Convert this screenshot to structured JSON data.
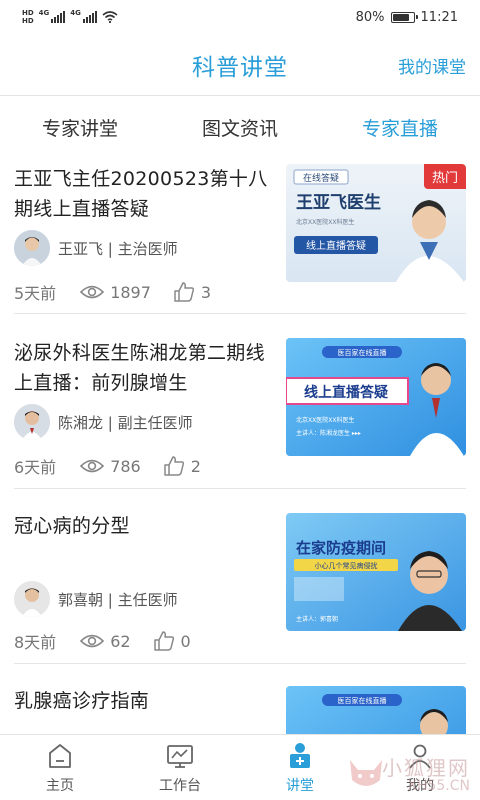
{
  "status_bar": {
    "hd1": "HD",
    "hd2": "HD",
    "net1": "4G",
    "net2": "4G",
    "battery_text": "80%",
    "battery_level": 0.8,
    "time": "11:21"
  },
  "header": {
    "title": "科普讲堂",
    "right_link": "我的课堂"
  },
  "tabs": [
    {
      "label": "专家讲堂",
      "active": false
    },
    {
      "label": "图文资讯",
      "active": false
    },
    {
      "label": "专家直播",
      "active": true
    }
  ],
  "items": [
    {
      "title": "王亚飞主任20200523第十八期线上直播答疑",
      "author": "王亚飞 | 主治医师",
      "date": "5天前",
      "views": "1897",
      "likes": "3",
      "badge": "热门",
      "thumb_text": [
        "在线答疑",
        "王亚飞医生",
        "北京XX医院XX科医生",
        "线上直播答疑"
      ]
    },
    {
      "title": "泌尿外科医生陈湘龙第二期线上直播：前列腺增生",
      "author": "陈湘龙 | 副主任医师",
      "date": "6天前",
      "views": "786",
      "likes": "2",
      "badge": "",
      "thumb_text": [
        "医百家在线直播",
        "线上直播答疑",
        "北京XX医院XX科医生",
        "主讲人：陈湘龙医生 ▸▸▸"
      ]
    },
    {
      "title": "冠心病的分型",
      "author": "郭喜朝 | 主任医师",
      "date": "8天前",
      "views": "62",
      "likes": "0",
      "badge": "",
      "thumb_text": [
        "在家防疫期间",
        "小心几个常见病侵扰",
        "主讲人：郭喜朝"
      ]
    },
    {
      "title": "乳腺癌诊疗指南",
      "author": "",
      "date": "",
      "views": "",
      "likes": "",
      "badge": "",
      "thumb_text": [
        "医百家在线直播"
      ]
    }
  ],
  "bottom_nav": [
    {
      "label": "主页",
      "icon": "home-icon",
      "active": false
    },
    {
      "label": "工作台",
      "icon": "workbench-icon",
      "active": false
    },
    {
      "label": "讲堂",
      "icon": "lecture-icon",
      "active": true
    },
    {
      "label": "我的",
      "icon": "profile-icon",
      "active": false
    }
  ],
  "watermark": {
    "text": "小狐狸网",
    "sub": "XH55.CN"
  },
  "colors": {
    "accent": "#2a9ed8",
    "hot": "#e23a3a"
  }
}
